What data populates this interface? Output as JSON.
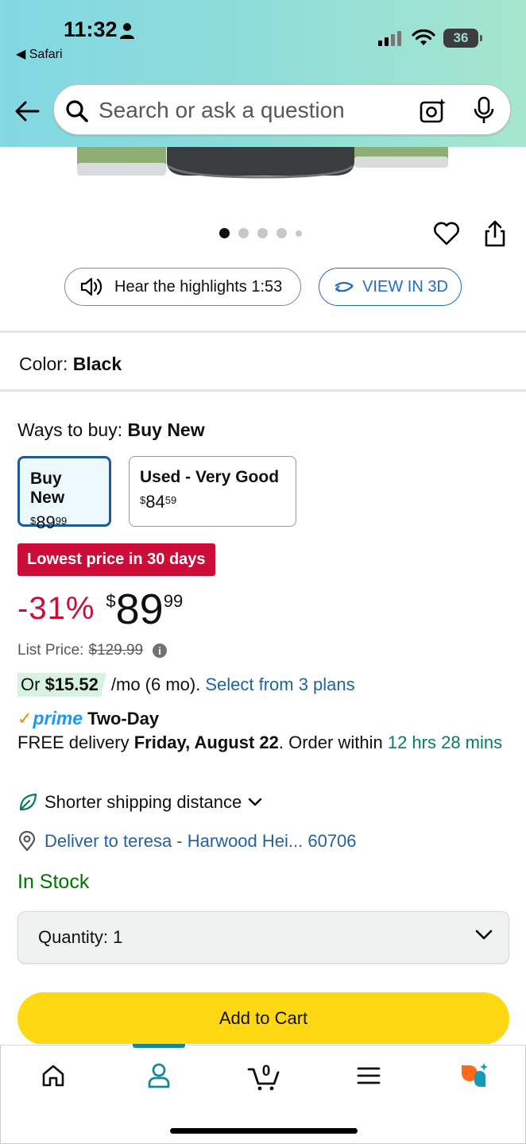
{
  "status_bar": {
    "time": "11:32",
    "back_app": "Safari",
    "battery": "36"
  },
  "search": {
    "placeholder": "Search or ask a question"
  },
  "carousel": {
    "count": 5,
    "active_index": 0
  },
  "media_buttons": {
    "hear_highlights": "Hear the highlights 1:53",
    "view_3d": "VIEW IN 3D"
  },
  "color": {
    "label": "Color:",
    "value": "Black"
  },
  "ways_to_buy": {
    "label": "Ways to buy:",
    "selected": "Buy New",
    "options": [
      {
        "label": "Buy New",
        "currency": "$",
        "whole": "89",
        "fraction": "99"
      },
      {
        "label": "Used - Very Good",
        "currency": "$",
        "whole": "84",
        "fraction": "59"
      }
    ]
  },
  "deal_badge": "Lowest price in 30 days",
  "price": {
    "discount": "-31%",
    "currency": "$",
    "whole": "89",
    "fraction": "99",
    "list_label": "List Price:",
    "list_value": "$129.99"
  },
  "installments": {
    "prefix": "Or",
    "amount": "$15.52",
    "terms": "/mo (6 mo).",
    "link": "Select from 3 plans"
  },
  "shipping": {
    "prime_check": "✓",
    "prime_word": "prime",
    "speed": "Two-Day",
    "free_delivery": "FREE delivery",
    "date": "Friday, August 22",
    "order_within": ". Order within",
    "countdown": "12 hrs 28 mins",
    "shorter_distance": "Shorter shipping distance",
    "deliver_to": "Deliver to teresa - Harwood Hei... 60706"
  },
  "availability": "In Stock",
  "quantity": {
    "label": "Quantity:",
    "value": "1"
  },
  "add_to_cart": "Add to Cart",
  "tabbar": {
    "cart_count": "0",
    "active_tab": "account",
    "accent": "#138997"
  },
  "colors": {
    "accent_teal": "#138997",
    "deal_red": "#cc0c39",
    "link_blue": "#2162a1",
    "stock_green": "#007600",
    "cart_yellow": "#ffd814"
  }
}
